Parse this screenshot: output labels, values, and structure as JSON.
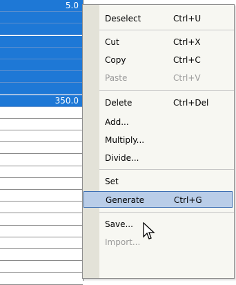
{
  "grid": {
    "selected_rows": [
      {
        "value": "5.0"
      },
      {
        "value": ""
      },
      {
        "value": ""
      },
      {
        "value": ""
      },
      {
        "value": ""
      },
      {
        "value": ""
      },
      {
        "value": ""
      },
      {
        "value": ""
      },
      {
        "value": "350.0"
      }
    ],
    "empty_rows": 15
  },
  "menu": {
    "deselect": {
      "label": "Deselect",
      "shortcut": "Ctrl+U"
    },
    "cut": {
      "label": "Cut",
      "shortcut": "Ctrl+X"
    },
    "copy": {
      "label": "Copy",
      "shortcut": "Ctrl+C"
    },
    "paste": {
      "label": "Paste",
      "shortcut": "Ctrl+V"
    },
    "delete": {
      "label": "Delete",
      "shortcut": "Ctrl+Del"
    },
    "add": {
      "label": "Add..."
    },
    "multiply": {
      "label": "Multiply..."
    },
    "divide": {
      "label": "Divide..."
    },
    "set": {
      "label": "Set"
    },
    "generate": {
      "label": "Generate",
      "shortcut": "Ctrl+G"
    },
    "save": {
      "label": "Save..."
    },
    "import": {
      "label": "Import..."
    }
  },
  "icons": {
    "cursor": "arrow-pointer-icon"
  }
}
